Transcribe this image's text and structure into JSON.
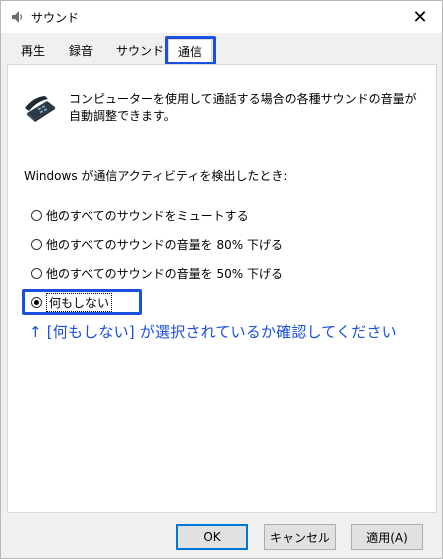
{
  "window": {
    "title": "サウンド",
    "close_glyph": "✕"
  },
  "tabs": [
    {
      "label": "再生",
      "selected": false
    },
    {
      "label": "録音",
      "selected": false
    },
    {
      "label": "サウンド",
      "selected": false
    },
    {
      "label": "通信",
      "selected": true
    }
  ],
  "panel": {
    "description": "コンピューターを使用して通話する場合の各種サウンドの音量が自動調整できます。",
    "question": "Windows が通信アクティビティを検出したとき:",
    "options": [
      {
        "label": "他のすべてのサウンドをミュートする",
        "checked": false
      },
      {
        "label": "他のすべてのサウンドの音量を 80% 下げる",
        "checked": false
      },
      {
        "label": "他のすべてのサウンドの音量を 50% 下げる",
        "checked": false
      },
      {
        "label": "何もしない",
        "checked": true
      }
    ],
    "annotation": "↑ [何もしない] が選択されているか確認してください"
  },
  "buttons": {
    "ok": "OK",
    "cancel": "キャンセル",
    "apply": "適用(A)"
  },
  "colors": {
    "highlight": "#1a4fe0",
    "default_button_border": "#0078d7"
  }
}
